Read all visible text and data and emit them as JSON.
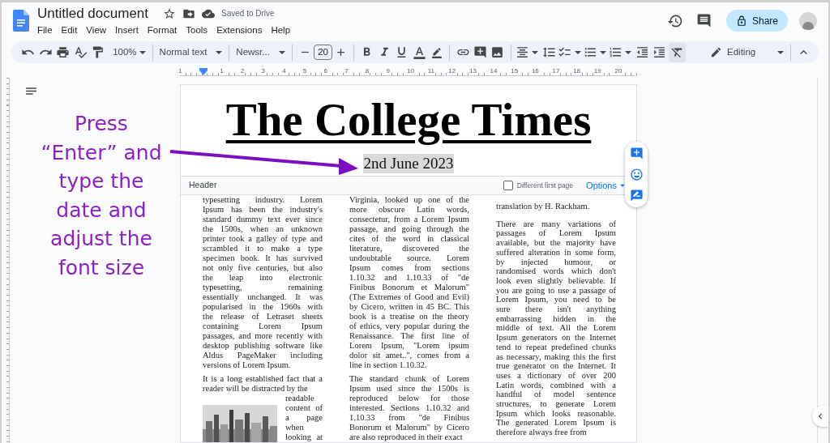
{
  "app": {
    "title": "Untitled document",
    "save_status": "Saved to Drive",
    "menu": [
      "File",
      "Edit",
      "View",
      "Insert",
      "Format",
      "Tools",
      "Extensions",
      "Help"
    ],
    "share_label": "Share"
  },
  "toolbar": {
    "zoom": "100%",
    "style": "Normal text",
    "font": "Newsr...",
    "font_size": "20",
    "clear_formatting_active": true,
    "mode": "Editing"
  },
  "ruler": {
    "labels": [
      "1",
      "1",
      "2",
      "3",
      "4",
      "5",
      "6",
      "7",
      "8",
      "9",
      "10",
      "11",
      "12",
      "13",
      "14",
      "15",
      "16",
      "17",
      "18",
      "19",
      "20"
    ]
  },
  "annotation": {
    "lines": [
      "Press",
      "“Enter” and",
      "type the",
      "date and",
      "adjust the",
      "font size"
    ]
  },
  "page": {
    "title": "The College Times",
    "date": "2nd June 2023",
    "header_bar": {
      "label": "Header",
      "different_first_page": {
        "label": "Different first page",
        "checked": false
      },
      "options": "Options"
    },
    "columns": [
      {
        "paragraphs": [
          {
            "lines": [
              "typesetting industry. Lorem",
              "Ipsum has been the industry's",
              "standard dummy text ever since",
              "the 1500s, when an unknown",
              "printer took a galley of type and",
              "scrambled it to make a type",
              "specimen book. It has survived",
              "not only five centuries, but also",
              "the leap into electronic",
              "typesetting, remaining",
              "essentially unchanged. It was",
              "popularised in the 1960s with",
              "the release of Letraset sheets",
              "containing Lorem Ipsum",
              "passages, and more recently with",
              "desktop publishing software like",
              "Aldus PageMaker including",
              "versions of Lorem Ipsum."
            ]
          },
          {
            "lines": [
              "It is a long established fact that a",
              "reader will be distracted by the"
            ],
            "wrap_lines": [
              "readable",
              "content of",
              "a page",
              "when",
              "looking at"
            ],
            "picture": {
              "kind": "picture"
            }
          }
        ]
      },
      {
        "paragraphs": [
          {
            "lines": [
              "Virginia, looked up one of the",
              "more obscure Latin words,",
              "consectetur, from a Lorem Ipsum",
              "passage, and going through the",
              "cites of the word in classical",
              "literature, discovered the",
              "undoubtable source. Lorem",
              "Ipsum comes from sections",
              "1.10.32 and 1.10.33 of \"de",
              "Finibus Bonorum et Malorum\"",
              "(The Extremes of Good and Evil)",
              "by Cicero, written in 45 BC. This",
              "book is a treatise on the theory",
              "of ethics, very popular during the",
              "Renaissance. The first line of",
              "Lorem Ipsum, \"Lorem ipsum",
              "dolor sit amet..\", comes from a",
              "line in section 1.10.32."
            ]
          },
          {
            "lines": [
              "The standard chunk of Lorem",
              "Ipsum used since the 1500s is",
              "reproduced below for those",
              "interested. Sections 1.10.32 and",
              "1.10.33 from \"de Finibus",
              "Bonorum et Malorum\" by Cicero",
              "are also reproduced in their exact"
            ]
          }
        ]
      },
      {
        "paragraphs": [
          {
            "lines": [
              "translation by H. Rackham."
            ]
          },
          {
            "lines": [
              "There are many variations of",
              "passages of Lorem Ipsum",
              "available, but the majority have",
              "suffered alteration in some form,",
              "by injected humour, or",
              "randomised words which don't",
              "look even slightly believable. If",
              "you are going to use a passage of",
              "Lorem Ipsum, you need to be",
              "sure there isn't anything",
              "embarrassing hidden in the",
              "middle of text. All the Lorem",
              "Ipsum generators on the Internet",
              "tend to repeat predefined chunks",
              "as necessary, making this the first",
              "true generator on the Internet. It",
              "uses a dictionary of over 200",
              "Latin words, combined with a",
              "handful of model sentence",
              "structures, to generate Lorem",
              "Ipsum which looks reasonable.",
              "The generated Lorem Ipsum is",
              "therefore always free from"
            ]
          }
        ]
      }
    ]
  }
}
